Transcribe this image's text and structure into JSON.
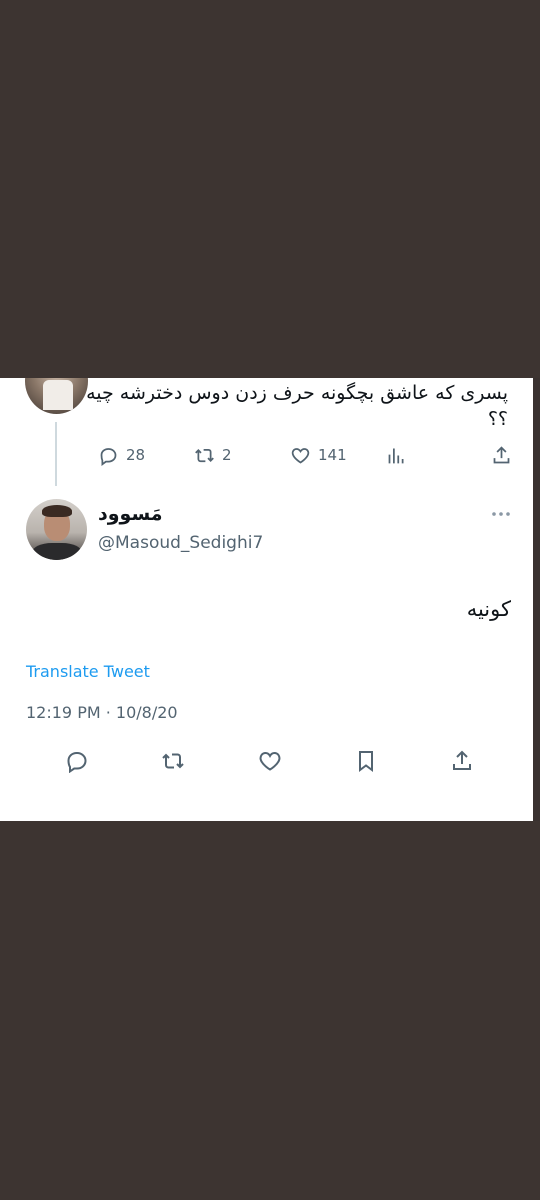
{
  "colors": {
    "background": "#3d3431",
    "card": "#ffffff",
    "text": "#0f1419",
    "muted": "#536471",
    "link": "#1d9bf0"
  },
  "parent_tweet": {
    "text": "پسری که عاشق بچگونه حرف زدن دوس دخترشه چیه ؟؟",
    "metrics": {
      "replies": "28",
      "retweets": "2",
      "likes": "141"
    },
    "icons": [
      "reply-icon",
      "retweet-icon",
      "like-icon",
      "views-icon",
      "share-icon"
    ]
  },
  "reply_tweet": {
    "display_name": "مَسوود",
    "handle": "@Masoud_Sedighi7",
    "text": "کونیه",
    "translate_label": "Translate Tweet",
    "timestamp": "12:19 PM · 10/8/20",
    "action_icons": [
      "reply-icon",
      "retweet-icon",
      "like-icon",
      "bookmark-icon",
      "share-icon"
    ],
    "more_icon": "more-icon"
  }
}
